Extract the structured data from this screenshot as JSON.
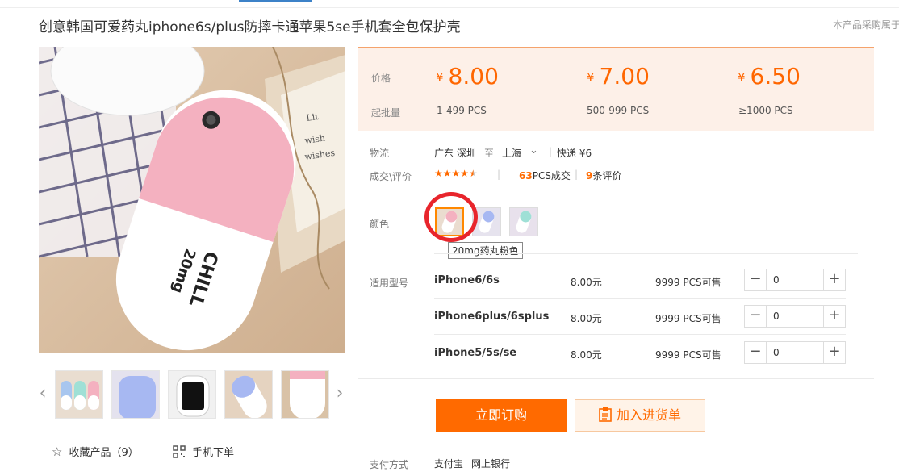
{
  "product": {
    "title": "创意韩国可爱药丸iphone6s/plus防摔卡通苹果5se手机套全包保护壳",
    "notice": "本产品采购属于"
  },
  "gallery": {
    "prev_icon": "chevron-left-icon",
    "next_icon": "chevron-right-icon",
    "thumb_count": 5
  },
  "actions": {
    "favorite_label": "收藏产品（9）",
    "mobile_label": "手机下单"
  },
  "pricing": {
    "price_label": "价格",
    "moq_label": "起批量",
    "currency": "¥",
    "tiers": [
      {
        "price": "8.00",
        "qty": "1-499 PCS"
      },
      {
        "price": "7.00",
        "qty": "500-999 PCS"
      },
      {
        "price": "6.50",
        "qty": "≥1000 PCS"
      }
    ]
  },
  "logistics": {
    "label": "物流",
    "from": "广东 深圳",
    "to_word": "至",
    "to": "上海",
    "express": "快递 ¥6"
  },
  "deals": {
    "label": "成交\\评价",
    "rating": 4.5,
    "sold_count": "63",
    "sold_suffix": "PCS成交",
    "review_count": "9",
    "review_suffix": "条评价"
  },
  "colors": {
    "label": "颜色",
    "tooltip": "20mg药丸粉色",
    "selected_index": 0
  },
  "models": {
    "label": "适用型号",
    "rows": [
      {
        "name": "iPhone6/6s",
        "price": "8.00元",
        "stock": "9999 PCS可售",
        "qty": "0"
      },
      {
        "name": "iPhone6plus/6splus",
        "price": "8.00元",
        "stock": "9999 PCS可售",
        "qty": "0"
      },
      {
        "name": "iPhone5/5s/se",
        "price": "8.00元",
        "stock": "9999 PCS可售",
        "qty": "0"
      }
    ]
  },
  "buttons": {
    "buy": "立即订购",
    "cart": "加入进货单"
  },
  "payment": {
    "label": "支付方式",
    "methods": [
      "支付宝",
      "网上银行"
    ]
  },
  "theme": {
    "accent": "#ff6a00",
    "price_bg": "#fdf0e8",
    "highlight_circle": "#e8252c"
  }
}
